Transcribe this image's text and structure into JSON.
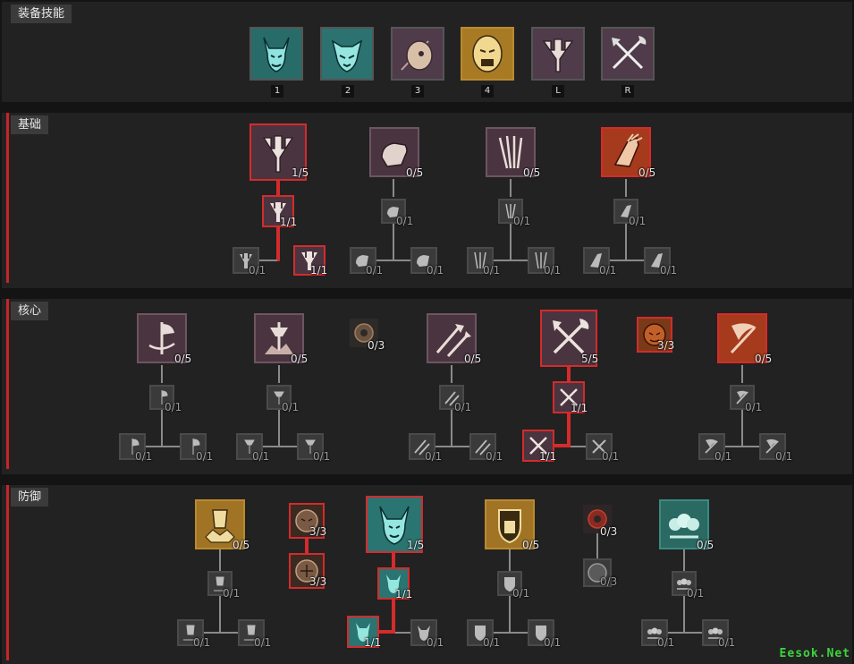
{
  "equipped": {
    "title": "装备技能",
    "slots": [
      {
        "key": "1",
        "icon": "berserker-demon-face-icon",
        "theme": "teal"
      },
      {
        "key": "2",
        "icon": "wild-beast-face-icon",
        "theme": "teal"
      },
      {
        "key": "3",
        "icon": "rallying-horn-icon",
        "theme": "purple"
      },
      {
        "key": "4",
        "icon": "war-cry-face-icon",
        "theme": "gold"
      },
      {
        "key": "L",
        "icon": "lunging-strike-icon",
        "theme": "purple"
      },
      {
        "key": "R",
        "icon": "crossed-axe-sword-icon",
        "theme": "purple"
      }
    ]
  },
  "sections": {
    "basic": {
      "title": "基础",
      "main": [
        {
          "icon": "lunging-strike-icon",
          "rank": "1/5",
          "selected": true
        },
        {
          "icon": "bash-fist-icon",
          "rank": "0/5",
          "selected": false
        },
        {
          "icon": "frenzy-blades-icon",
          "rank": "0/5",
          "selected": false
        },
        {
          "icon": "flay-gauntlet-icon",
          "rank": "0/5",
          "selected": true
        }
      ],
      "upgrade": [
        "1/1",
        "0/1",
        "0/1",
        "0/1"
      ],
      "choices": [
        [
          "0/1",
          "1/1"
        ],
        [
          "0/1",
          "0/1"
        ],
        [
          "0/1",
          "0/1"
        ],
        [
          "0/1",
          "0/1"
        ]
      ]
    },
    "core": {
      "title": "核心",
      "main": [
        {
          "icon": "whirlwind-axe-icon",
          "rank": "0/5",
          "selected": false
        },
        {
          "icon": "upheaval-icon",
          "rank": "0/5",
          "selected": false
        },
        {
          "icon": "double-swing-icon",
          "rank": "0/5",
          "selected": false
        },
        {
          "icon": "hammer-of-ancients-icon",
          "rank": "5/5",
          "selected": true
        },
        {
          "icon": "rend-scythe-icon",
          "rank": "0/5",
          "selected": true
        }
      ],
      "passives": [
        {
          "icon": "pit-fighter-icon",
          "rank": "0/3"
        },
        {
          "icon": "no-mercy-icon",
          "rank": "3/3"
        }
      ],
      "upgrade": [
        "0/1",
        "0/1",
        "0/1",
        "1/1",
        "0/1"
      ],
      "choices": [
        [
          "0/1",
          "0/1"
        ],
        [
          "0/1",
          "0/1"
        ],
        [
          "0/1",
          "0/1"
        ],
        [
          "1/1",
          "0/1"
        ],
        [
          "0/1",
          "0/1"
        ]
      ]
    },
    "defensive": {
      "title": "防御",
      "main": [
        {
          "icon": "iron-skin-icon",
          "rank": "0/5",
          "selected": false
        },
        {
          "icon": "challenging-shout-icon",
          "rank": "1/5",
          "selected": true
        },
        {
          "icon": "rallying-cry-icon",
          "rank": "0/5",
          "selected": false
        },
        {
          "icon": "ground-stomp-icon",
          "rank": "0/5",
          "selected": false
        }
      ],
      "passives": [
        {
          "icon": "imposing-presence-icon",
          "rank": "3/3"
        },
        {
          "icon": "martial-vigor-icon",
          "rank": "3/3"
        },
        {
          "icon": "outburst-icon",
          "rank": "0/3"
        },
        {
          "icon": "tough-as-nails-icon",
          "rank": "0/3"
        }
      ],
      "upgrade": [
        "0/1",
        "1/1",
        "0/1",
        "0/1"
      ],
      "choices": [
        [
          "0/1",
          "0/1"
        ],
        [
          "1/1",
          "0/1"
        ],
        [
          "0/1",
          "0/1"
        ],
        [
          "0/1",
          "0/1"
        ]
      ]
    }
  },
  "watermark": "Eesok.Net",
  "colors": {
    "accent": "#d42b2b",
    "panel": "#222222",
    "teal": "#2f7f7c",
    "gold": "#b98a2e",
    "purple": "#6a4a5a",
    "orange": "#b5481e"
  }
}
